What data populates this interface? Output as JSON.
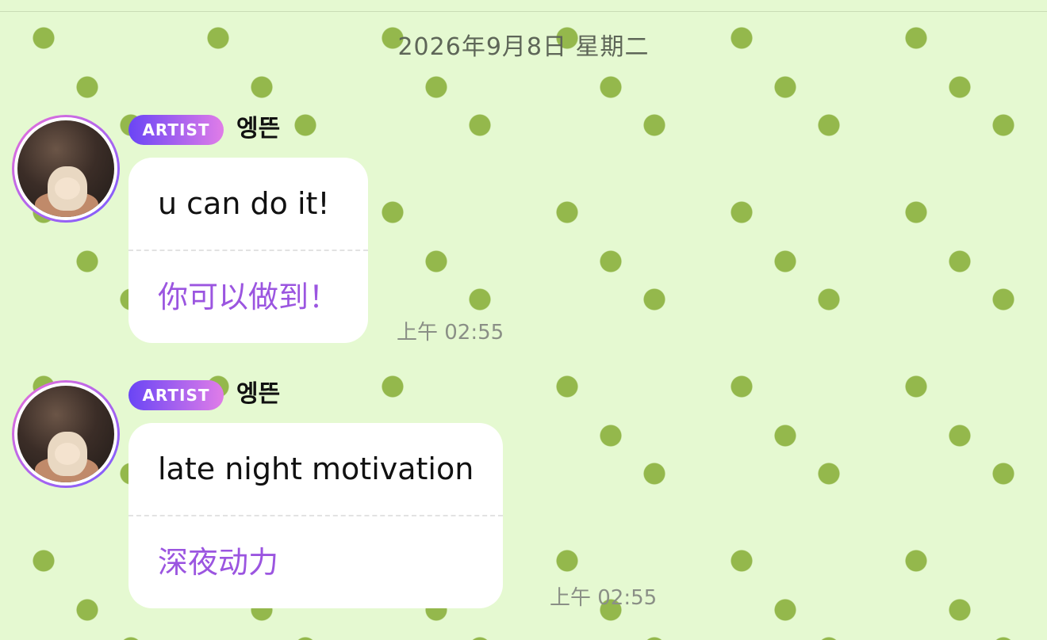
{
  "date_separator": "2026年9月8日 星期二",
  "messages": [
    {
      "badge": "ARTIST",
      "sender": "엥뜬",
      "text": "u can do it!",
      "translation": "你可以做到！",
      "time": "上午 02:55"
    },
    {
      "badge": "ARTIST",
      "sender": "엥뜬",
      "text": "late night motivation",
      "translation": "深夜动力",
      "time": "上午 02:55"
    }
  ],
  "colors": {
    "background": "#e5f9d1",
    "dots": "#94b84c",
    "translation_text": "#9b55e0",
    "badge_gradient_start": "#6a45f5",
    "badge_gradient_end": "#e07de8"
  }
}
